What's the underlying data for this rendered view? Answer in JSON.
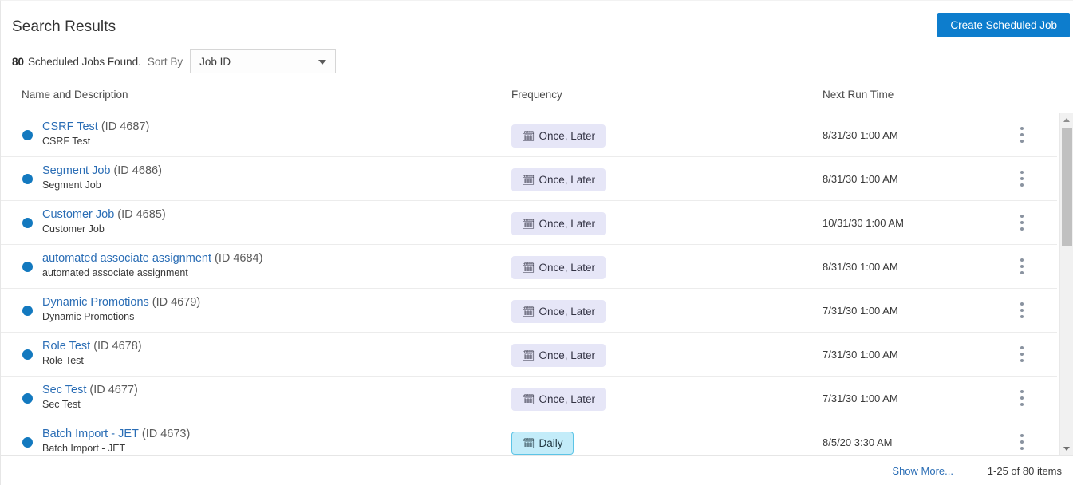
{
  "header": {
    "title": "Search Results",
    "create_button": "Create Scheduled Job",
    "count": "80",
    "count_label": "Scheduled Jobs Found.",
    "sort_label": "Sort By",
    "sort_value": "Job ID",
    "sort_options": [
      "Job ID"
    ]
  },
  "columns": {
    "name": "Name and Description",
    "frequency": "Frequency",
    "next_run": "Next Run Time"
  },
  "rows": [
    {
      "name": "CSRF Test",
      "id": "(ID 4687)",
      "description": "CSRF Test",
      "frequency": "Once, Later",
      "frequency_type": "once",
      "frequency_icon": "calendar-icon",
      "next_run": "8/31/30 1:00 AM",
      "status": "active"
    },
    {
      "name": "Segment Job",
      "id": "(ID 4686)",
      "description": "Segment Job",
      "frequency": "Once, Later",
      "frequency_type": "once",
      "frequency_icon": "calendar-icon",
      "next_run": "8/31/30 1:00 AM",
      "status": "active"
    },
    {
      "name": "Customer Job",
      "id": "(ID 4685)",
      "description": "Customer Job",
      "frequency": "Once, Later",
      "frequency_type": "once",
      "frequency_icon": "calendar-icon",
      "next_run": "10/31/30 1:00 AM",
      "status": "active"
    },
    {
      "name": "automated associate assignment",
      "id": "(ID 4684)",
      "description": "automated associate assignment",
      "frequency": "Once, Later",
      "frequency_type": "once",
      "frequency_icon": "calendar-icon",
      "next_run": "8/31/30 1:00 AM",
      "status": "active"
    },
    {
      "name": "Dynamic Promotions",
      "id": "(ID 4679)",
      "description": "Dynamic Promotions",
      "frequency": "Once, Later",
      "frequency_type": "once",
      "frequency_icon": "calendar-icon",
      "next_run": "7/31/30 1:00 AM",
      "status": "active"
    },
    {
      "name": "Role Test",
      "id": "(ID 4678)",
      "description": "Role Test",
      "frequency": "Once, Later",
      "frequency_type": "once",
      "frequency_icon": "calendar-icon",
      "next_run": "7/31/30 1:00 AM",
      "status": "active"
    },
    {
      "name": "Sec Test",
      "id": "(ID 4677)",
      "description": "Sec Test",
      "frequency": "Once, Later",
      "frequency_type": "once",
      "frequency_icon": "calendar-icon",
      "next_run": "7/31/30 1:00 AM",
      "status": "active"
    },
    {
      "name": "Batch Import - JET",
      "id": "(ID 4673)",
      "description": "Batch Import - JET",
      "frequency": "Daily",
      "frequency_type": "daily",
      "frequency_icon": "calendar-icon",
      "next_run": "8/5/20 3:30 AM",
      "status": "active"
    }
  ],
  "footer": {
    "show_more": "Show More...",
    "page_count": "1-25 of 80 items"
  },
  "colors": {
    "accent_blue": "#0d7dcd",
    "link_blue": "#2a6db5",
    "status_dot": "#1379bf",
    "badge_once_bg": "#e6e6f7",
    "badge_daily_bg": "#c3ecf9",
    "badge_daily_border": "#5cc4e6"
  },
  "icons": {
    "calendar": "🗓",
    "kebab": "kebab-menu-icon",
    "caret_down": "chevron-down-icon"
  }
}
